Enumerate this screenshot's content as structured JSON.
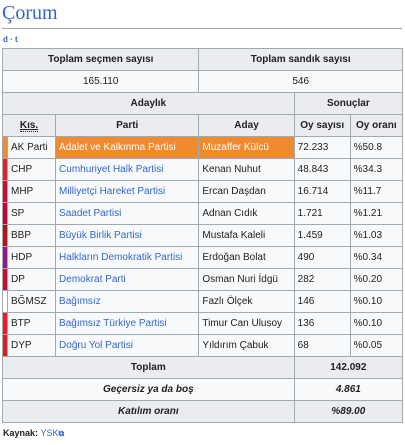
{
  "page": {
    "title": "Çorum",
    "navbox": "d · t"
  },
  "summary": {
    "voters_label": "Toplam seçmen sayısı",
    "ballot_label": "Toplam sandık sayısı",
    "voters_value": "165.110",
    "ballot_value": "546"
  },
  "headers": {
    "candidacy": "Adaylık",
    "results": "Sonuçlar",
    "abbr": "Kıs.",
    "party": "Parti",
    "candidate": "Aday",
    "votes": "Oy sayısı",
    "share": "Oy oranı"
  },
  "rows": [
    {
      "abbr": "AK Parti",
      "party": "Adalet ve Kalkınma Partisi",
      "candidate": "Muzaffer Külcü",
      "votes": "72.233",
      "share": "%50.8",
      "color": "#f08a2e",
      "highlight": true
    },
    {
      "abbr": "CHP",
      "party": "Cumhuriyet Halk Partisi",
      "candidate": "Kenan Nuhut",
      "votes": "48.843",
      "share": "%34.3",
      "color": "#e41e2b"
    },
    {
      "abbr": "MHP",
      "party": "Milliyetçi Hareket Partisi",
      "candidate": "Ercan Daşdan",
      "votes": "16.714",
      "share": "%11.7",
      "color": "#c8102e"
    },
    {
      "abbr": "SP",
      "party": "Saadet Partisi",
      "candidate": "Adnan Cıdık",
      "votes": "1.721",
      "share": "%1.21",
      "color": "#cc0033"
    },
    {
      "abbr": "BBP",
      "party": "Büyük Birlik Partisi",
      "candidate": "Mustafa Kaleli",
      "votes": "1.459",
      "share": "%1.03",
      "color": "#b5121b"
    },
    {
      "abbr": "HDP",
      "party": "Halkların Demokratik Partisi",
      "candidate": "Erdoğan Bolat",
      "votes": "490",
      "share": "%0.34",
      "color": "#8b1a8b"
    },
    {
      "abbr": "DP",
      "party": "Demokrat Parti",
      "candidate": "Osman Nuri İdgü",
      "votes": "282",
      "share": "%0.20",
      "color": "#c8102e"
    },
    {
      "abbr": "BĞMSZ",
      "party": "Bağımsız",
      "candidate": "Fazlı Ölçek",
      "votes": "146",
      "share": "%0.10",
      "color": "#ffffff"
    },
    {
      "abbr": "BTP",
      "party": "Bağımsız Türkiye Partisi",
      "candidate": "Timur Can Ulusoy",
      "votes": "136",
      "share": "%0.10",
      "color": "#ee1c25"
    },
    {
      "abbr": "DYP",
      "party": "Doğru Yol Partisi",
      "candidate": "Yıldırım Çabuk",
      "votes": "68",
      "share": "%0.05",
      "color": "#d61f26"
    }
  ],
  "totals": {
    "total_label": "Toplam",
    "total_value": "142.092",
    "invalid_label": "Geçersiz ya da boş",
    "invalid_value": "4.861",
    "turnout_label": "Katılım oranı",
    "turnout_value": "%89.00"
  },
  "source": {
    "label": "Kaynak:",
    "link": "YSK"
  }
}
